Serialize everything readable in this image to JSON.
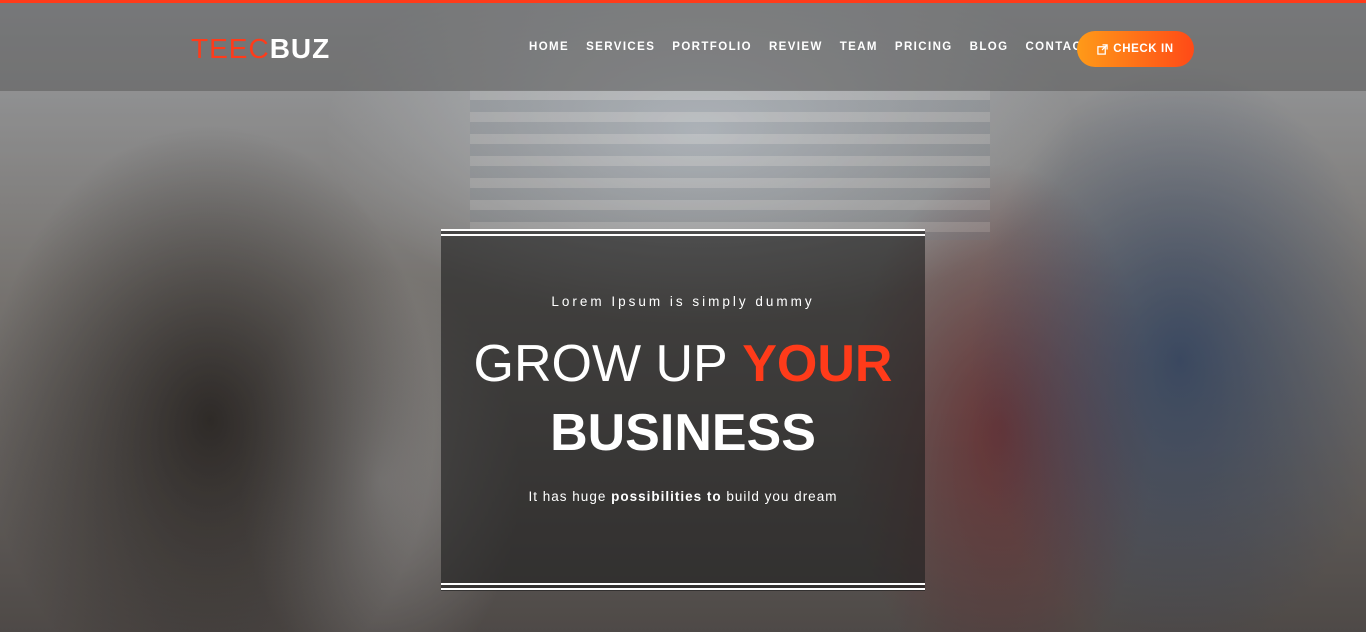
{
  "brand": {
    "logo_part1": "TEEC",
    "logo_part2": "BUZ",
    "accent_color": "#ff3b1a",
    "button_gradient": [
      "#ff9a18",
      "#ff4a17"
    ]
  },
  "nav": {
    "items": [
      {
        "label": "HOME"
      },
      {
        "label": "SERVICES"
      },
      {
        "label": "PORTFOLIO"
      },
      {
        "label": "REVIEW"
      },
      {
        "label": "TEAM"
      },
      {
        "label": "PRICING"
      },
      {
        "label": "BLOG"
      },
      {
        "label": "CONTACT"
      }
    ],
    "cta_label": "CHECK IN",
    "cta_icon": "external-link-icon"
  },
  "hero": {
    "tagline": "Lorem Ipsum is simply dummy",
    "headline_thin": "GROW UP",
    "headline_accent": "YOUR",
    "headline_line2": "BUSINESS",
    "subtext_pre": "It has huge",
    "subtext_bold": "possibilities to",
    "subtext_post": "build you dream"
  }
}
